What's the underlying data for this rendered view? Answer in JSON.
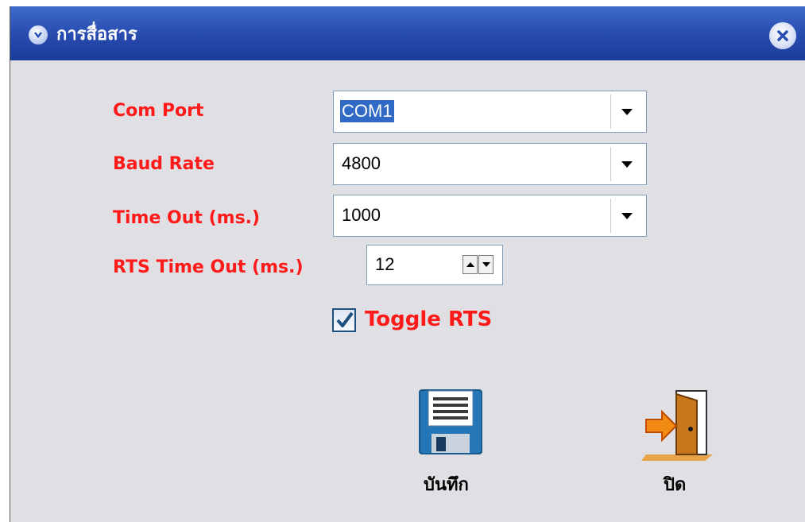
{
  "window": {
    "title": "การสื่อสาร",
    "title_icon": "chevron-down-circle-icon",
    "close_icon": "close-icon"
  },
  "form": {
    "com_port": {
      "label": "Com Port",
      "value": "COM1"
    },
    "baud_rate": {
      "label": "Baud Rate",
      "value": "4800"
    },
    "time_out": {
      "label": "Time Out (ms.)",
      "value": "1000"
    },
    "rts_time_out": {
      "label": "RTS Time Out (ms.)",
      "value": "12"
    },
    "toggle_rts": {
      "label": "Toggle RTS",
      "checked": true
    }
  },
  "buttons": {
    "save": {
      "label": "บันทึก",
      "icon": "floppy-disk-icon"
    },
    "close": {
      "label": "ปิด",
      "icon": "exit-door-icon"
    }
  },
  "colors": {
    "label_red": "#ff1a1a",
    "titlebar_blue": "#2a4fb3",
    "selection_blue": "#316ac5",
    "window_bg": "#e0dfe3"
  }
}
